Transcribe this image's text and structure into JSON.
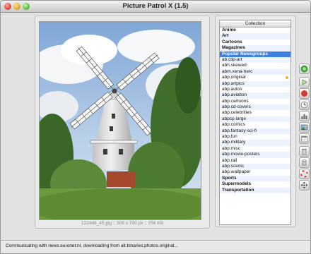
{
  "window": {
    "title": "Picture Patrol X (1.5)"
  },
  "image": {
    "info": "122448_45.jpg :: 509 x 700 px :: 256 KB"
  },
  "collection": {
    "header": "Collection",
    "rows": [
      {
        "label": "Anime",
        "kind": "group"
      },
      {
        "label": "Art",
        "kind": "group"
      },
      {
        "label": "Cartoons",
        "kind": "group"
      },
      {
        "label": "Magazines",
        "kind": "group"
      },
      {
        "label": "Popular Newsgroups",
        "kind": "selected"
      },
      {
        "label": "ab.clip-art",
        "kind": "item"
      },
      {
        "label": "abh.skewed",
        "kind": "item"
      },
      {
        "label": "abm.xena-herc",
        "kind": "item"
      },
      {
        "label": "abp.original",
        "kind": "item",
        "badge": true
      },
      {
        "label": "abp.artpics",
        "kind": "item"
      },
      {
        "label": "abp.autos",
        "kind": "item"
      },
      {
        "label": "abp.aviation",
        "kind": "item"
      },
      {
        "label": "abp.cartoons",
        "kind": "item"
      },
      {
        "label": "abp.cd-covers",
        "kind": "item"
      },
      {
        "label": "abp.celebrities",
        "kind": "item"
      },
      {
        "label": "abpcp.large",
        "kind": "item"
      },
      {
        "label": "abp.comics",
        "kind": "item"
      },
      {
        "label": "abp.fantasy-sci-fi",
        "kind": "item"
      },
      {
        "label": "abp.fun",
        "kind": "item"
      },
      {
        "label": "abp.military",
        "kind": "item"
      },
      {
        "label": "abp.misc",
        "kind": "item"
      },
      {
        "label": "abp.movie-posters",
        "kind": "item"
      },
      {
        "label": "abp.rail",
        "kind": "item"
      },
      {
        "label": "abp.scenic",
        "kind": "item"
      },
      {
        "label": "abp.wallpaper",
        "kind": "item"
      },
      {
        "label": "Sports",
        "kind": "group"
      },
      {
        "label": "Supermodels",
        "kind": "group"
      },
      {
        "label": "Transportation",
        "kind": "group"
      }
    ]
  },
  "toolbar_icons": [
    "record-icon",
    "play-icon",
    "stop-icon",
    "clock-icon",
    "chart-icon",
    "picture-icon",
    "calendar-icon",
    "trash-icon",
    "cylinder-icon",
    "lifebuoy-icon",
    "move-icon"
  ],
  "status": {
    "text": "Communicating with news.euronet.nl, downloading from alt.binaries.photos.original..."
  },
  "colors": {
    "selection": "#3d80df",
    "badge": "#f0b23a",
    "record_green": "#3ca02d",
    "stop_red": "#d23b35"
  }
}
